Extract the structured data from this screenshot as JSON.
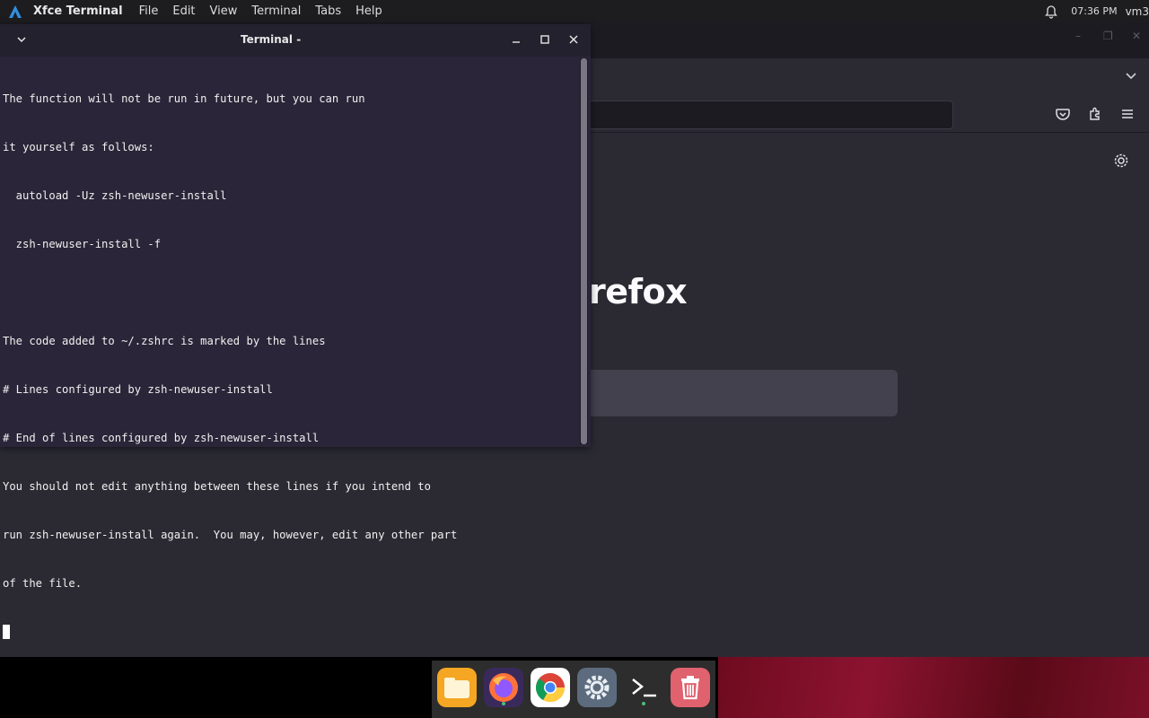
{
  "top_panel": {
    "app_name": "Xfce Terminal",
    "menus": [
      "File",
      "Edit",
      "View",
      "Terminal",
      "Tabs",
      "Help"
    ],
    "clock": "07:36 PM",
    "user": "vm3"
  },
  "terminal": {
    "title": "Terminal -",
    "lines": [
      "The function will not be run in future, but you can run",
      "it yourself as follows:",
      "  autoload -Uz zsh-newuser-install",
      "  zsh-newuser-install -f",
      "",
      "The code added to ~/.zshrc is marked by the lines",
      "# Lines configured by zsh-newuser-install",
      "# End of lines configured by zsh-newuser-install",
      "You should not edit anything between these lines if you intend to",
      "run zsh-newuser-install again.  You may, however, edit any other part",
      "of the file."
    ]
  },
  "firefox": {
    "logo_text": "refox"
  },
  "dock": {
    "items": [
      "files-icon",
      "firefox-icon",
      "chrome-icon",
      "settings-icon",
      "terminal-icon",
      "trash-icon"
    ]
  },
  "colors": {
    "terminal_bg": "#2a2538",
    "panel_bg": "#1d1d1f",
    "firefox_bg": "#2b2a33"
  }
}
